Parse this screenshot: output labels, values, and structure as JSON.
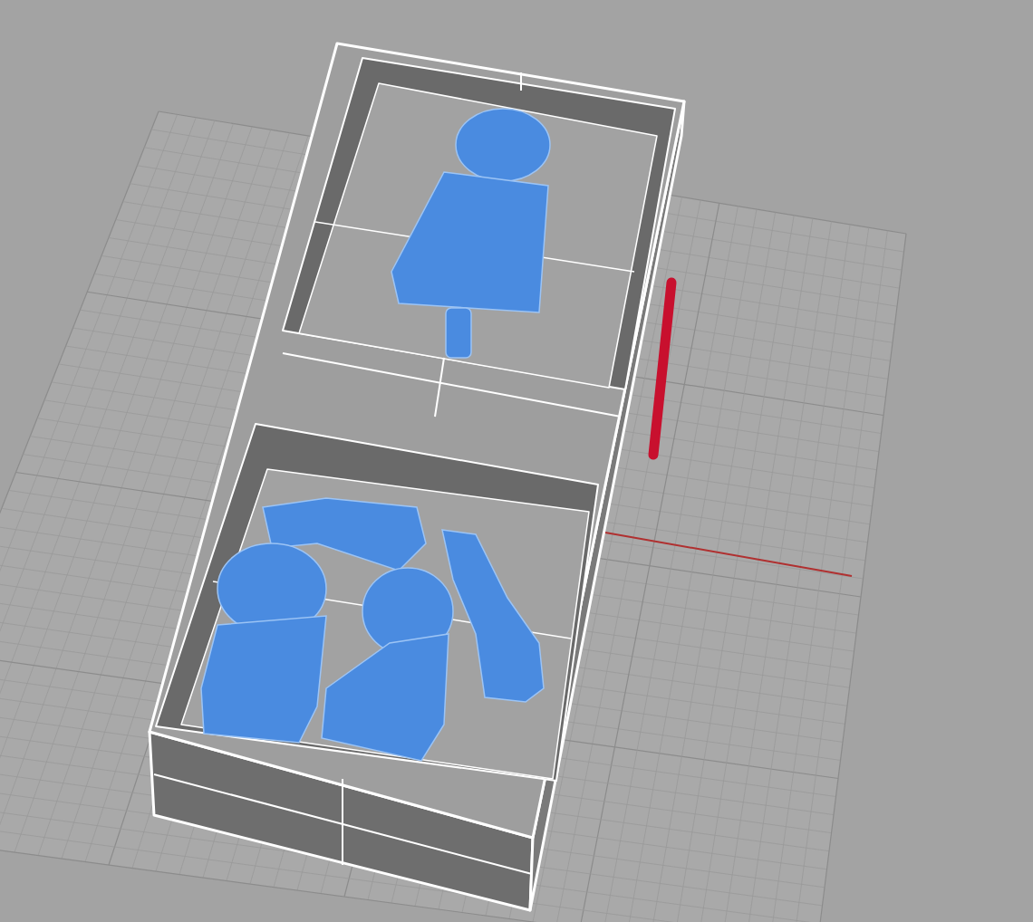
{
  "viewport": {
    "objects": [
      {
        "kind": "grid",
        "selected": false
      },
      {
        "kind": "axis",
        "selected": false
      },
      {
        "kind": "box",
        "selected": false
      },
      {
        "kind": "parts",
        "selected": false
      },
      {
        "kind": "rod",
        "selected": true
      }
    ]
  }
}
